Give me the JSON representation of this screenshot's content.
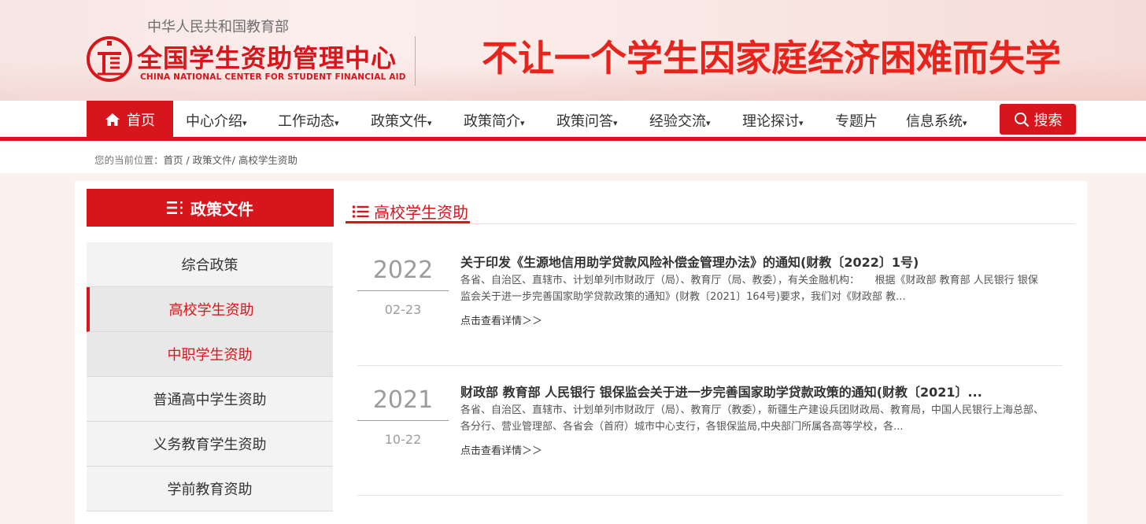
{
  "header": {
    "ministry": "中华人民共和国教育部",
    "center_name": "全国学生资助管理中心",
    "center_name_en": "CHINA NATIONAL CENTER FOR STUDENT FINANCIAL AID",
    "slogan": "不让一个学生因家庭经济困难而失学",
    "brand_color": "#d7151d"
  },
  "nav": {
    "home": "首页",
    "items": [
      "中心介绍",
      "工作动态",
      "政策文件",
      "政策简介",
      "政策问答",
      "经验交流",
      "理论探讨",
      "专题片",
      "信息系统"
    ],
    "search": "搜索"
  },
  "breadcrumb": {
    "label": "您的当前位置：",
    "path": "首页 / 政策文件/ 高校学生资助"
  },
  "sidebar": {
    "title": "政策文件",
    "items": [
      {
        "label": "综合政策"
      },
      {
        "label": "高校学生资助"
      },
      {
        "label": "中职学生资助"
      },
      {
        "label": "普通高中学生资助"
      },
      {
        "label": "义务教育学生资助"
      },
      {
        "label": "学前教育资助"
      }
    ]
  },
  "section": {
    "title": "高校学生资助"
  },
  "articles": [
    {
      "year": "2022",
      "date": "02-23",
      "title": "关于印发《生源地信用助学贷款风险补偿金管理办法》的通知(财教〔2022〕1号)",
      "summary": "各省、自治区、直辖市、计划单列市财政厅（局）、教育厅（局、教委），有关金融机构：　　根据《财政部 教育部 人民银行 银保监会关于进一步完善国家助学贷款政策的通知》(财教〔2021〕164号)要求，我们对《财政部 教...",
      "more": "点击查看详情＞＞"
    },
    {
      "year": "2021",
      "date": "10-22",
      "title": "财政部 教育部 人民银行 银保监会关于进一步完善国家助学贷款政策的通知(财教〔2021〕...",
      "summary": "各省、自治区、直辖市、计划单列市财政厅（局）、教育厅（教委），新疆生产建设兵团财政局、教育局，中国人民银行上海总部、各分行、营业管理部、各省会（首府）城市中心支行，各银保监局,中央部门所属各高等学校，各...",
      "more": "点击查看详情＞＞"
    }
  ]
}
